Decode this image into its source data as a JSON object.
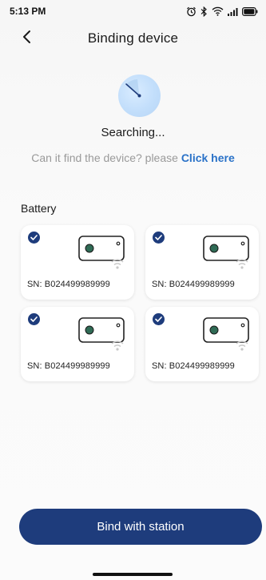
{
  "status_bar": {
    "time": "5:13 PM",
    "icons": [
      "alarm-icon",
      "bluetooth-icon",
      "wifi-icon",
      "signal-icon",
      "battery-icon"
    ]
  },
  "header": {
    "title": "Binding device",
    "back_icon": "chevron-left-icon"
  },
  "search": {
    "status": "Searching...",
    "prompt": "Can it find the device? please",
    "link": "Click here"
  },
  "section": {
    "label": "Battery"
  },
  "devices": [
    {
      "sn": "SN: B024499989999",
      "checked": true
    },
    {
      "sn": "SN: B024499989999",
      "checked": true
    },
    {
      "sn": "SN: B024499989999",
      "checked": true
    },
    {
      "sn": "SN: B024499989999",
      "checked": true
    }
  ],
  "actions": {
    "bind_label": "Bind with station"
  },
  "colors": {
    "primary": "#1e3c7c",
    "link": "#2a72c8",
    "muted_text": "#9a9a9a",
    "radar": "#c2defb"
  }
}
